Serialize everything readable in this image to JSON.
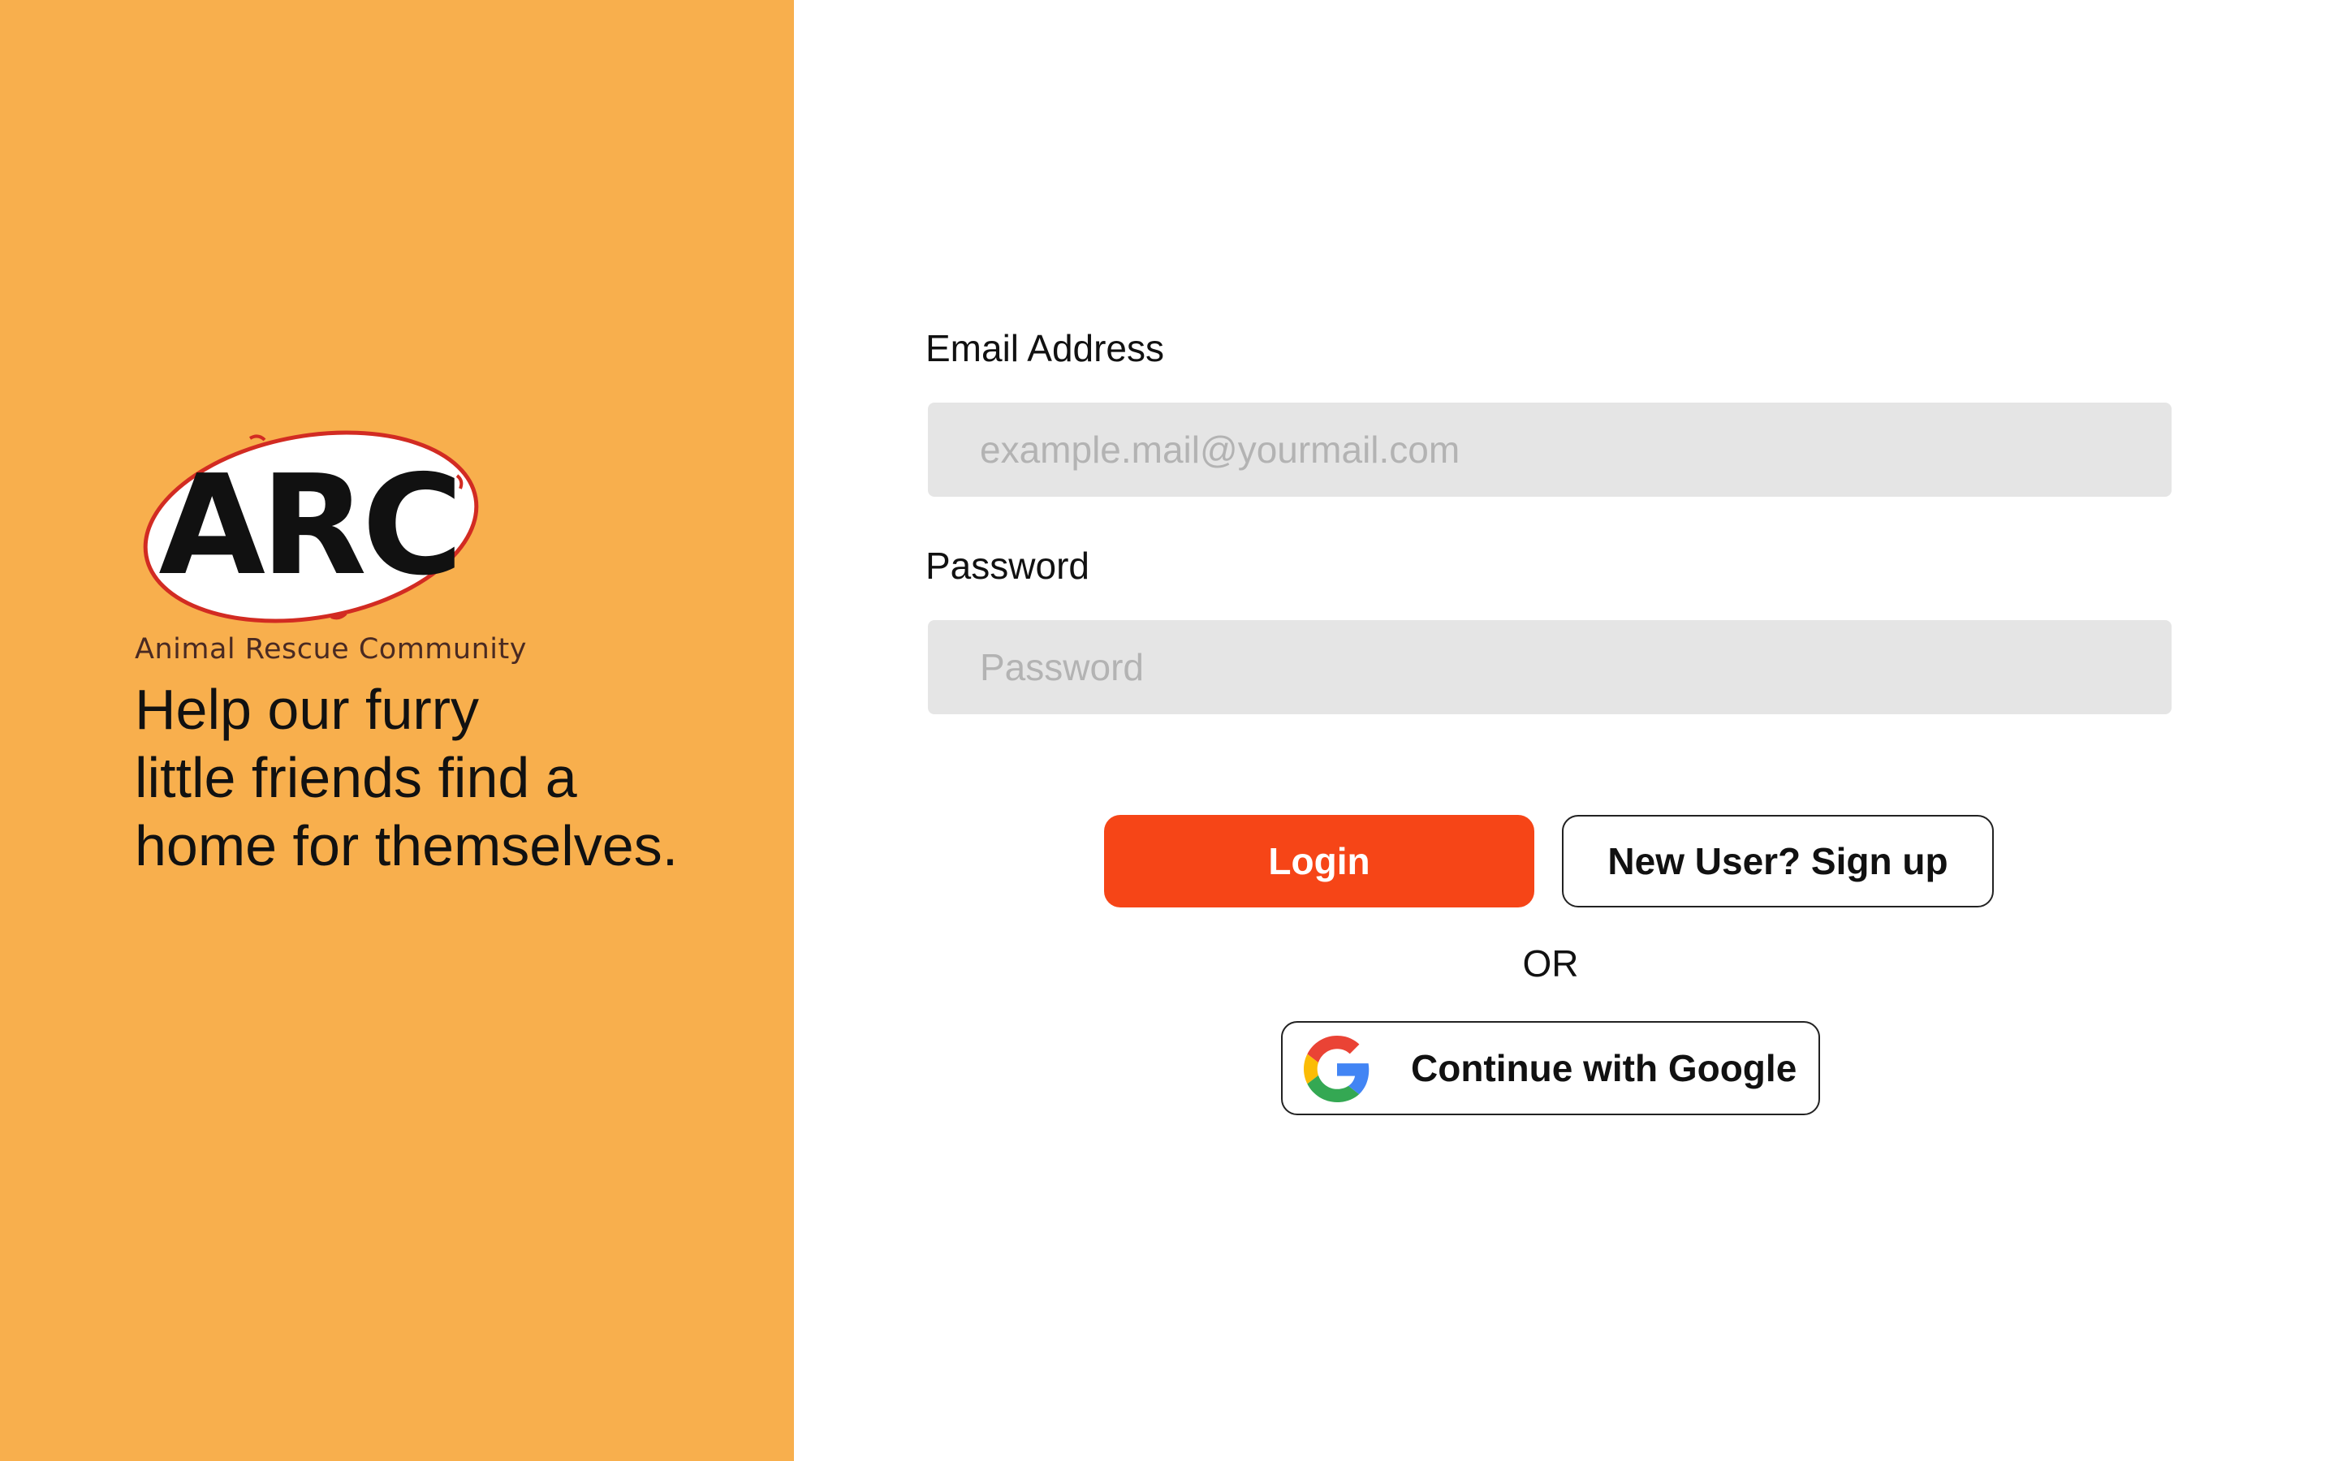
{
  "brand": {
    "logo_text": "ARC",
    "subtitle": "Animal Rescue Community",
    "tagline_lines": [
      "Help our furry",
      "little friends find a",
      "home for themselves."
    ]
  },
  "form": {
    "email_label": "Email Address",
    "email_placeholder": "example.mail@yourmail.com",
    "email_value": "",
    "password_label": "Password",
    "password_placeholder": "Password",
    "password_value": "",
    "login_label": "Login",
    "signup_label": "New User? Sign up",
    "or_text": "OR",
    "google_label": "Continue with Google"
  },
  "icons": {
    "google": "google-icon",
    "logo": "arc-logo"
  },
  "colors": {
    "left_panel_bg": "#f8af4d",
    "login_button": "#f64517",
    "input_bg": "#e5e5e5",
    "logo_ring": "#d22b22"
  }
}
